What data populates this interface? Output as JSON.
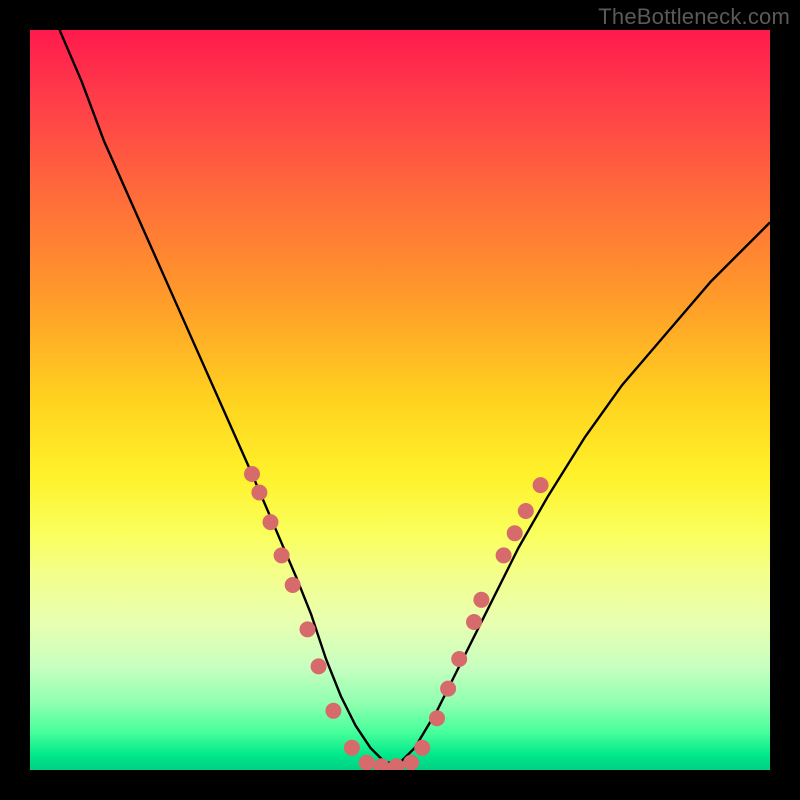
{
  "watermark_text": "TheBottleneck.com",
  "chart_data": {
    "type": "line",
    "title": "",
    "xlabel": "",
    "ylabel": "",
    "xlim": [
      0,
      100
    ],
    "ylim": [
      0,
      100
    ],
    "grid": false,
    "legend_position": "none",
    "annotations": [
      "TheBottleneck.com"
    ],
    "background_gradient_stops": [
      {
        "pos": 0.0,
        "color": "#ff1a4d"
      },
      {
        "pos": 0.1,
        "color": "#ff3f49"
      },
      {
        "pos": 0.22,
        "color": "#ff6a3b"
      },
      {
        "pos": 0.36,
        "color": "#ff9a2a"
      },
      {
        "pos": 0.5,
        "color": "#ffd21f"
      },
      {
        "pos": 0.6,
        "color": "#fff12a"
      },
      {
        "pos": 0.68,
        "color": "#faff5c"
      },
      {
        "pos": 0.74,
        "color": "#f2ff8e"
      },
      {
        "pos": 0.8,
        "color": "#e8ffb0"
      },
      {
        "pos": 0.86,
        "color": "#c8ffc0"
      },
      {
        "pos": 0.91,
        "color": "#8fffb0"
      },
      {
        "pos": 0.95,
        "color": "#44ff9a"
      },
      {
        "pos": 0.98,
        "color": "#00e88a"
      },
      {
        "pos": 1.0,
        "color": "#00d084"
      }
    ],
    "series": [
      {
        "name": "bottleneck-curve",
        "color": "#000000",
        "x": [
          4,
          7,
          10,
          14,
          18,
          22,
          26,
          30,
          33,
          36,
          38,
          40,
          42,
          44,
          46,
          48,
          50,
          52,
          55,
          58,
          62,
          66,
          70,
          75,
          80,
          86,
          92,
          100
        ],
        "y": [
          100,
          93,
          85,
          76,
          67,
          58,
          49,
          40,
          33,
          26,
          21,
          15,
          10,
          6,
          3,
          1,
          1,
          3,
          8,
          14,
          22,
          30,
          37,
          45,
          52,
          59,
          66,
          74
        ]
      }
    ],
    "markers": [
      {
        "x": 30.0,
        "y": 40.0
      },
      {
        "x": 31.0,
        "y": 37.5
      },
      {
        "x": 32.5,
        "y": 33.5
      },
      {
        "x": 34.0,
        "y": 29.0
      },
      {
        "x": 35.5,
        "y": 25.0
      },
      {
        "x": 37.5,
        "y": 19.0
      },
      {
        "x": 39.0,
        "y": 14.0
      },
      {
        "x": 41.0,
        "y": 8.0
      },
      {
        "x": 43.5,
        "y": 3.0
      },
      {
        "x": 45.5,
        "y": 1.0
      },
      {
        "x": 47.5,
        "y": 0.5
      },
      {
        "x": 49.5,
        "y": 0.5
      },
      {
        "x": 51.5,
        "y": 1.0
      },
      {
        "x": 53.0,
        "y": 3.0
      },
      {
        "x": 55.0,
        "y": 7.0
      },
      {
        "x": 56.5,
        "y": 11.0
      },
      {
        "x": 58.0,
        "y": 15.0
      },
      {
        "x": 60.0,
        "y": 20.0
      },
      {
        "x": 61.0,
        "y": 23.0
      },
      {
        "x": 64.0,
        "y": 29.0
      },
      {
        "x": 65.5,
        "y": 32.0
      },
      {
        "x": 67.0,
        "y": 35.0
      },
      {
        "x": 69.0,
        "y": 38.5
      }
    ],
    "marker_style": {
      "color": "#d76a6a",
      "radius_px": 8
    }
  }
}
